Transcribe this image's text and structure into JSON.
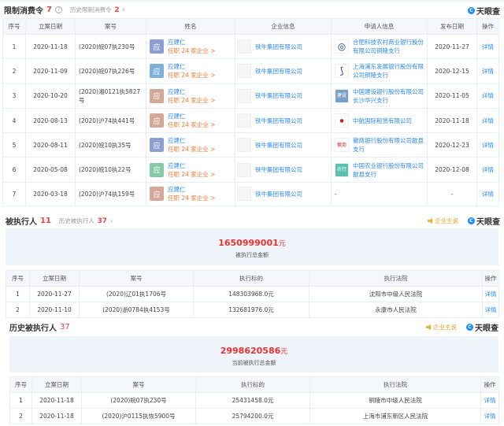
{
  "section1": {
    "title": "限制消费令",
    "count": "7",
    "history_label": "历史限制消费令",
    "history_count": "2",
    "brand": "天眼查",
    "headers": [
      "序号",
      "立案日期",
      "案号",
      "姓名",
      "企业信息",
      "申请人信息",
      "发布日期",
      "操作"
    ],
    "rows": [
      {
        "no": "1",
        "date": "2020-11-18",
        "case": "(2020)皖07执230号",
        "avatar": "应",
        "avatar_color": "#8d9ed0",
        "name": "应建仁",
        "jobs": "任职 24 家企业 >",
        "company": "铁牛集团有限公司",
        "applicant": "合肥科技农村商业银行股份有限公司铜陵支行",
        "pub": "2020-11-27",
        "op": "详情"
      },
      {
        "no": "2",
        "date": "2020-11-09",
        "case": "(2020)皖07执226号",
        "avatar": "应",
        "avatar_color": "#7fb0dc",
        "name": "应建仁",
        "jobs": "任职 24 家企业 >",
        "company": "铁牛集团有限公司",
        "applicant": "上海浦东发展银行股份有限公司铜陵支行",
        "pub": "2020-12-15",
        "op": "详情"
      },
      {
        "no": "3",
        "date": "2020-10-20",
        "case": "(2020)湘0121执5827号",
        "avatar": "应",
        "avatar_color": "#d4a898",
        "name": "应建仁",
        "jobs": "任职 24 家企业 >",
        "company": "铁牛集团有限公司",
        "applicant": "中国建设银行股份有限公司长沙华兴支行",
        "pub": "2020-11-05",
        "op": "详情"
      },
      {
        "no": "4",
        "date": "2020-08-13",
        "case": "(2020)沪74执441号",
        "avatar": "应",
        "avatar_color": "#d4a898",
        "name": "应建仁",
        "jobs": "任职 24 家企业 >",
        "company": "铁牛集团有限公司",
        "applicant": "中航国际租赁有限公司",
        "pub": "2020-11-18",
        "op": "详情"
      },
      {
        "no": "5",
        "date": "2020-08-11",
        "case": "(2020)皖10执35号",
        "avatar": "应",
        "avatar_color": "#8d9ed0",
        "name": "应建仁",
        "jobs": "任职 24 家企业 >",
        "company": "铁牛集团有限公司",
        "applicant": "徽商银行股份有限公司歙县支行",
        "pub": "2020-12-23",
        "op": "详情"
      },
      {
        "no": "6",
        "date": "2020-05-08",
        "case": "(2020)皖10执22号",
        "avatar": "应",
        "avatar_color": "#86c8a8",
        "name": "应建仁",
        "jobs": "任职 24 家企业 >",
        "company": "铁牛集团有限公司",
        "applicant": "中国农业银行股份有限公司歙县支行",
        "pub": "2020-12-08",
        "op": "详情"
      },
      {
        "no": "7",
        "date": "2020-03-18",
        "case": "(2020)沪74执159号",
        "avatar": "应",
        "avatar_color": "#d4a898",
        "name": "应建仁",
        "jobs": "任职 24 家企业 >",
        "company": "铁牛集团有限公司",
        "applicant": "-",
        "pub": "-",
        "op": "详情"
      }
    ]
  },
  "section2": {
    "title": "被执行人",
    "count": "11",
    "history_label": "历史被执行人",
    "history_count": "37",
    "says": "企业主说",
    "brand": "天眼查",
    "amount": "1650999001",
    "unit": "元",
    "amount_label": "被执行总金额",
    "headers": [
      "序号",
      "立案日期",
      "案号",
      "执行标的",
      "执行法院",
      "操作"
    ],
    "rows": [
      {
        "no": "1",
        "date": "2020-11-27",
        "case": "(2020)辽01执1706号",
        "target": "148303968.0元",
        "court": "沈阳市中级人民法院",
        "op": "详情"
      },
      {
        "no": "2",
        "date": "2020-11-10",
        "case": "(2020)浙0784执4153号",
        "target": "132681976.0元",
        "court": "永康市人民法院",
        "op": "详情"
      }
    ]
  },
  "section3": {
    "title": "历史被执行人",
    "count": "37",
    "says": "企业主说",
    "brand": "天眼查",
    "amount": "2998620586",
    "unit": "元",
    "amount_label": "当前被执行总金额",
    "headers": [
      "序号",
      "立案日期",
      "案号",
      "执行标的",
      "执行法院",
      "操作"
    ],
    "rows": [
      {
        "no": "1",
        "date": "2020-11-18",
        "case": "(2020)皖07执230号",
        "target": "25431458.0元",
        "court": "铜陵市中级人民法院",
        "op": "详情"
      },
      {
        "no": "2",
        "date": "2020-11-18",
        "case": "(2020)沪0115执恢5900号",
        "target": "25794200.0元",
        "court": "上海市浦东新区人民法院",
        "op": "详情"
      }
    ]
  }
}
